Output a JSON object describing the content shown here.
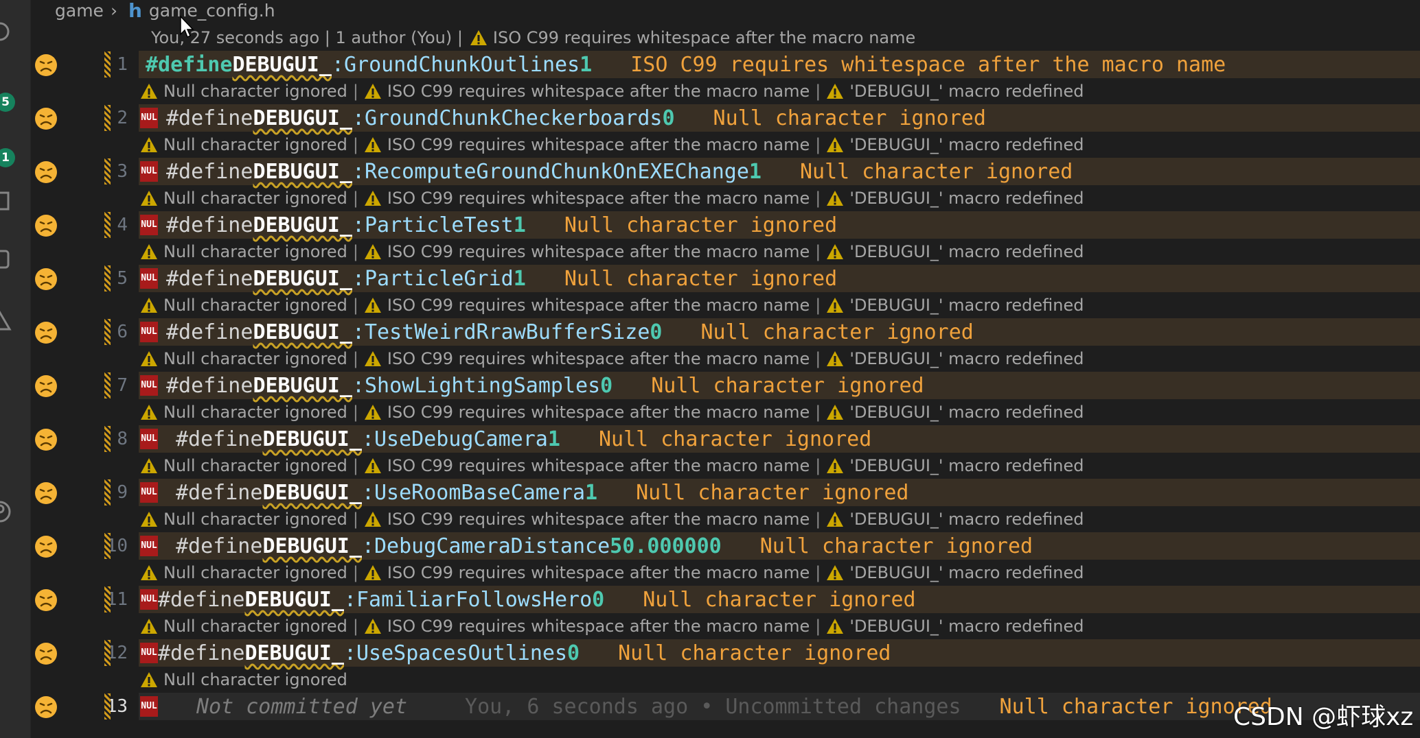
{
  "breadcrumb": {
    "folder": "game",
    "file": "game_config.h",
    "file_icon": "h"
  },
  "blame_header": {
    "text": "You, 27 seconds ago | 1 author (You) |",
    "warning": "ISO C99 requires whitespace after the macro name"
  },
  "activity_badges": [
    "5",
    "1"
  ],
  "annotations": {
    "null_char": "Null character ignored",
    "iso": "ISO C99 requires whitespace after the macro name",
    "redefined": "'DEBUGUI_' macro redefined",
    "separator": "|"
  },
  "nul_badge": "NUL",
  "lines": [
    {
      "num": "1",
      "define": "#define",
      "macro": "DEBUGUI_",
      "name": ":GroundChunkOutlines",
      "value": "1",
      "diag": "ISO C99 requires whitespace after the macro name"
    },
    {
      "num": "2",
      "define": "#define",
      "macro": "DEBUGUI_",
      "name": ":GroundChunkCheckerboards",
      "value": "0",
      "diag": "Null character ignored"
    },
    {
      "num": "3",
      "define": "#define",
      "macro": "DEBUGUI_",
      "name": ":RecomputeGroundChunkOnEXEChange",
      "value": "1",
      "diag": "Null character ignored"
    },
    {
      "num": "4",
      "define": "#define",
      "macro": "DEBUGUI_",
      "name": ":ParticleTest",
      "value": "1",
      "diag": "Null character ignored"
    },
    {
      "num": "5",
      "define": "#define",
      "macro": "DEBUGUI_",
      "name": ":ParticleGrid",
      "value": "1",
      "diag": "Null character ignored"
    },
    {
      "num": "6",
      "define": "#define",
      "macro": "DEBUGUI_",
      "name": ":TestWeirdRrawBufferSize",
      "value": "0",
      "diag": "Null character ignored"
    },
    {
      "num": "7",
      "define": "#define",
      "macro": "DEBUGUI_",
      "name": ":ShowLightingSamples",
      "value": "0",
      "diag": "Null character ignored"
    },
    {
      "num": "8",
      "define": "#define",
      "macro": "DEBUGUI_",
      "name": ":UseDebugCamera",
      "value": "1",
      "diag": "Null character ignored"
    },
    {
      "num": "9",
      "define": "#define",
      "macro": "DEBUGUI_",
      "name": ":UseRoomBaseCamera",
      "value": "1",
      "diag": "Null character ignored"
    },
    {
      "num": "10",
      "define": "#define",
      "macro": "DEBUGUI_",
      "name": ":DebugCameraDistance",
      "value": "50.000000",
      "diag": "Null character ignored"
    },
    {
      "num": "11",
      "define": "#define",
      "macro": "DEBUGUI_",
      "name": ":FamiliarFollowsHero",
      "value": "0",
      "diag": "Null character ignored"
    },
    {
      "num": "12",
      "define": "#define",
      "macro": "DEBUGUI_",
      "name": ":UseSpacesOutlines",
      "value": "0",
      "diag": "Null character ignored"
    }
  ],
  "last_line": {
    "num": "13",
    "blame": "Not committed yet",
    "blame_detail": "You, 6 seconds ago • Uncommitted changes",
    "diag": "Null character ignored"
  },
  "watermark": "CSDN @虾球xz"
}
